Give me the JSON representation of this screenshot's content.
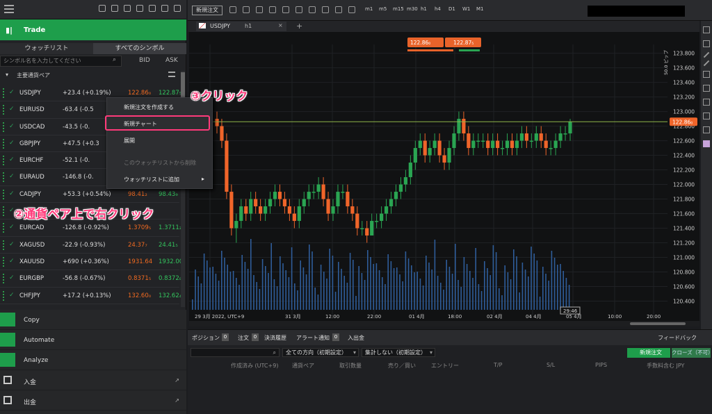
{
  "left": {
    "trade_label": "Trade",
    "tab_watchlist": "ウォッチリスト",
    "tab_all_symbols": "すべてのシンボル",
    "search_placeholder": "シンボル名を入力してください",
    "col_bid": "BID",
    "col_ask": "ASK",
    "group_name": "主要通貨ペア",
    "rows": [
      {
        "symbol": "USDJPY",
        "change": "+23.4 (+0.19%)",
        "bid": "122.86₀",
        "ask": "122.87₅"
      },
      {
        "symbol": "EURUSD",
        "change": "-63.4 (-0.5",
        "bid": "",
        "ask": ""
      },
      {
        "symbol": "USDCAD",
        "change": "-43.5 (-0.",
        "bid": "",
        "ask": ""
      },
      {
        "symbol": "GBPJPY",
        "change": "+47.5 (+0.3",
        "bid": "",
        "ask": ""
      },
      {
        "symbol": "EURCHF",
        "change": "-52.1 (-0.",
        "bid": "",
        "ask": ""
      },
      {
        "symbol": "EURAUD",
        "change": "-146.8 (-0.",
        "bid": "",
        "ask": ""
      },
      {
        "symbol": "CADJPY",
        "change": "+53.3 (+0.54%)",
        "bid": "98.41₂",
        "ask": "98.43₉"
      },
      {
        "symbol": "",
        "change": "",
        "bid": "",
        "ask": ""
      },
      {
        "symbol": "EURCAD",
        "change": "-126.8 (-0.92%)",
        "bid": "1.3709₅",
        "ask": "1.3711₂"
      },
      {
        "symbol": "XAGUSD",
        "change": "-22.9 (-0.93%)",
        "bid": "24.37₇",
        "ask": "24.41₅"
      },
      {
        "symbol": "XAUUSD",
        "change": "+690 (+0.36%)",
        "bid": "1931.64",
        "ask": "1932.00"
      },
      {
        "symbol": "EURGBP",
        "change": "-56.8 (-0.67%)",
        "bid": "0.8371₅",
        "ask": "0.8372₈"
      },
      {
        "symbol": "CHFJPY",
        "change": "+17.2 (+0.13%)",
        "bid": "132.60₀",
        "ask": "132.62₄"
      }
    ],
    "nav": [
      {
        "label": "Copy",
        "ext": ""
      },
      {
        "label": "Automate",
        "ext": ""
      },
      {
        "label": "Analyze",
        "ext": ""
      },
      {
        "label": "入金",
        "ext": "↗"
      },
      {
        "label": "出金",
        "ext": "↗"
      }
    ]
  },
  "context_menu": {
    "item1": "新規注文を作成する",
    "item2": "新規チャート",
    "item3": "展開",
    "item4": "このウォッチリストから削除",
    "item5": "ウォッチリストに追加",
    "item5_arrow": "▸"
  },
  "annotations": {
    "step3": "③クリック",
    "step2": "②通貨ペア上で右クリック"
  },
  "toolbar": {
    "new_order": "新規注文",
    "timeframes": [
      "m1",
      "m5",
      "m15",
      "m30",
      "h1",
      "h4",
      "D1",
      "W1",
      "M1"
    ]
  },
  "chart_tab": {
    "symbol": "USDJPY",
    "timeframe": "h1",
    "add": "+"
  },
  "chart_data": {
    "type": "candlestick",
    "symbol": "USDJPY",
    "sell_price": "122.86₀",
    "buy_price": "122.87₅",
    "current_price": "122.86₀",
    "pip_scale": "50.0 ピップ",
    "countdown": "29:46",
    "y_ticks": [
      "123.800",
      "123.600",
      "123.400",
      "123.200",
      "123.000",
      "122.800",
      "122.600",
      "122.400",
      "122.200",
      "122.000",
      "121.800",
      "121.600",
      "121.400",
      "121.200",
      "121.000",
      "120.800",
      "120.600",
      "120.400"
    ],
    "x_ticks": [
      "29 3月 2022, UTC+9",
      "31 3月",
      "12:00",
      "22:00",
      "01 4月",
      "18:00",
      "02 4月",
      "04 4月",
      "05 4月",
      "10:00",
      "20:00"
    ],
    "ylim": [
      120.3,
      123.92
    ],
    "candles": [
      [
        122.9,
        123.0,
        122.7,
        122.8
      ],
      [
        122.8,
        122.9,
        122.5,
        122.6
      ],
      [
        122.6,
        122.7,
        121.8,
        121.9
      ],
      [
        121.9,
        122.0,
        121.3,
        121.4
      ],
      [
        121.4,
        121.6,
        121.2,
        121.5
      ],
      [
        121.5,
        121.8,
        121.4,
        121.7
      ],
      [
        121.7,
        121.8,
        121.5,
        121.6
      ],
      [
        121.6,
        121.9,
        121.5,
        121.8
      ],
      [
        121.8,
        121.9,
        121.6,
        121.7
      ],
      [
        121.7,
        121.8,
        121.5,
        121.6
      ],
      [
        121.6,
        121.8,
        121.5,
        121.7
      ],
      [
        121.7,
        121.9,
        121.6,
        121.8
      ],
      [
        121.8,
        122.0,
        121.7,
        121.9
      ],
      [
        121.9,
        122.0,
        121.7,
        121.8
      ],
      [
        121.8,
        121.9,
        121.6,
        121.7
      ],
      [
        121.7,
        121.8,
        121.5,
        121.6
      ],
      [
        121.6,
        121.7,
        121.4,
        121.5
      ],
      [
        121.5,
        121.8,
        121.4,
        121.7
      ],
      [
        121.7,
        121.9,
        121.6,
        121.8
      ],
      [
        121.8,
        122.0,
        121.7,
        121.9
      ],
      [
        121.9,
        122.0,
        121.8,
        121.9
      ],
      [
        121.9,
        122.1,
        121.8,
        122.0
      ],
      [
        122.0,
        122.1,
        121.7,
        121.8
      ],
      [
        121.8,
        121.9,
        121.5,
        121.6
      ],
      [
        121.6,
        121.8,
        121.5,
        121.7
      ],
      [
        121.7,
        122.0,
        121.6,
        121.9
      ],
      [
        121.9,
        122.0,
        121.8,
        121.9
      ],
      [
        121.9,
        122.0,
        121.6,
        121.7
      ],
      [
        121.7,
        121.8,
        121.5,
        121.6
      ],
      [
        121.6,
        121.7,
        121.3,
        121.4
      ],
      [
        121.4,
        121.5,
        121.3,
        121.4
      ],
      [
        121.4,
        121.5,
        121.2,
        121.3
      ],
      [
        121.3,
        121.6,
        121.3,
        121.5
      ],
      [
        121.5,
        121.6,
        121.4,
        121.5
      ],
      [
        121.5,
        121.7,
        121.4,
        121.6
      ],
      [
        121.6,
        121.8,
        121.5,
        121.7
      ],
      [
        121.7,
        121.9,
        121.6,
        121.8
      ],
      [
        121.8,
        122.0,
        121.7,
        121.9
      ],
      [
        121.9,
        122.1,
        121.8,
        122.0
      ],
      [
        122.0,
        122.2,
        121.9,
        122.1
      ],
      [
        122.1,
        122.4,
        122.0,
        122.3
      ],
      [
        122.3,
        122.6,
        122.2,
        122.5
      ],
      [
        122.5,
        122.7,
        122.4,
        122.6
      ],
      [
        122.6,
        122.7,
        122.3,
        122.4
      ],
      [
        122.4,
        122.6,
        122.3,
        122.5
      ],
      [
        122.5,
        122.7,
        122.4,
        122.6
      ],
      [
        122.6,
        122.7,
        122.3,
        122.4
      ],
      [
        122.4,
        122.5,
        122.2,
        122.3
      ],
      [
        122.3,
        122.6,
        122.2,
        122.5
      ],
      [
        122.5,
        122.8,
        122.4,
        122.7
      ],
      [
        122.7,
        123.0,
        122.6,
        122.9
      ],
      [
        122.9,
        123.0,
        122.6,
        122.7
      ],
      [
        122.7,
        122.8,
        122.4,
        122.5
      ],
      [
        122.5,
        122.7,
        122.4,
        122.6
      ],
      [
        122.6,
        122.7,
        122.5,
        122.6
      ],
      [
        122.6,
        122.7,
        122.5,
        122.6
      ],
      [
        122.6,
        122.7,
        122.4,
        122.5
      ],
      [
        122.5,
        122.7,
        122.4,
        122.6
      ],
      [
        122.6,
        122.7,
        122.4,
        122.5
      ],
      [
        122.5,
        122.6,
        122.4,
        122.5
      ],
      [
        122.5,
        122.7,
        122.4,
        122.6
      ],
      [
        122.6,
        122.7,
        122.4,
        122.5
      ],
      [
        122.5,
        122.7,
        122.4,
        122.6
      ],
      [
        122.6,
        122.8,
        122.5,
        122.7
      ],
      [
        122.7,
        122.8,
        122.5,
        122.6
      ],
      [
        122.6,
        122.7,
        122.5,
        122.6
      ],
      [
        122.6,
        122.8,
        122.5,
        122.7
      ],
      [
        122.7,
        122.8,
        122.5,
        122.6
      ],
      [
        122.6,
        122.7,
        122.4,
        122.5
      ],
      [
        122.5,
        122.6,
        122.4,
        122.5
      ],
      [
        122.5,
        122.7,
        122.4,
        122.6
      ],
      [
        122.6,
        122.8,
        122.5,
        122.7
      ],
      [
        122.7,
        122.8,
        122.6,
        122.7
      ],
      [
        122.7,
        122.9,
        122.6,
        122.86
      ]
    ]
  },
  "bottom": {
    "tabs": [
      {
        "label": "ポジション",
        "count": "0"
      },
      {
        "label": "注文",
        "count": "0"
      },
      {
        "label": "決済履歴",
        "count": ""
      },
      {
        "label": "アラート通知",
        "count": "0"
      },
      {
        "label": "入出金",
        "count": ""
      }
    ],
    "feedback": "フィードバック",
    "direction_select": "全ての方向（初期設定）",
    "aggregate_select": "集計しない（初期設定）",
    "new_order_btn": "新規注文",
    "close_btn": "クローズ（不可）",
    "columns": [
      "作成済み (UTC+9)",
      "通貨ペア",
      "取引数量",
      "売り／買い",
      "エントリー",
      "T/P",
      "S/L",
      "PIPS",
      "手数料含む JPY"
    ]
  }
}
